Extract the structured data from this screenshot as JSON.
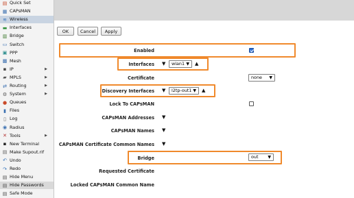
{
  "sidebar": {
    "items": [
      {
        "label": "Quick Set",
        "icon": "quick-set-icon",
        "glyph": "▤"
      },
      {
        "label": "CAPsMAN",
        "icon": "capsman-icon",
        "glyph": "▦"
      },
      {
        "label": "Wireless",
        "icon": "wireless-icon",
        "glyph": "≋"
      },
      {
        "label": "Interfaces",
        "icon": "interfaces-icon",
        "glyph": "▬"
      },
      {
        "label": "Bridge",
        "icon": "bridge-icon",
        "glyph": "▥"
      },
      {
        "label": "Switch",
        "icon": "switch-icon",
        "glyph": "▭"
      },
      {
        "label": "PPP",
        "icon": "ppp-icon",
        "glyph": "▣"
      },
      {
        "label": "Mesh",
        "icon": "mesh-icon",
        "glyph": "▩"
      },
      {
        "label": "IP",
        "icon": "ip-icon",
        "glyph": "▪"
      },
      {
        "label": "MPLS",
        "icon": "mpls-icon",
        "glyph": "▰"
      },
      {
        "label": "Routing",
        "icon": "routing-icon",
        "glyph": "⇄"
      },
      {
        "label": "System",
        "icon": "system-icon",
        "glyph": "⚙"
      },
      {
        "label": "Queues",
        "icon": "queues-icon",
        "glyph": "●"
      },
      {
        "label": "Files",
        "icon": "files-icon",
        "glyph": "▮"
      },
      {
        "label": "Log",
        "icon": "log-icon",
        "glyph": "▯"
      },
      {
        "label": "Radius",
        "icon": "radius-icon",
        "glyph": "◉"
      },
      {
        "label": "Tools",
        "icon": "tools-icon",
        "glyph": "✕"
      },
      {
        "label": "New Terminal",
        "icon": "terminal-icon",
        "glyph": "▪"
      },
      {
        "label": "Make Supout.rif",
        "icon": "supout-icon",
        "glyph": "▤"
      },
      {
        "label": "Undo",
        "icon": "undo-icon",
        "glyph": "↶"
      },
      {
        "label": "Redo",
        "icon": "redo-icon",
        "glyph": "↷"
      },
      {
        "label": "Hide Menu",
        "icon": "hide-menu-icon",
        "glyph": "▤"
      },
      {
        "label": "Hide Passwords",
        "icon": "hide-passwords-icon",
        "glyph": "▤"
      },
      {
        "label": "Safe Mode",
        "icon": "safe-mode-icon",
        "glyph": "▤"
      }
    ],
    "submenu_arrow": "▶",
    "selected": "Wireless"
  },
  "toolbar": {
    "ok_label": "OK",
    "cancel_label": "Cancel",
    "apply_label": "Apply"
  },
  "form": {
    "enabled": {
      "label": "Enabled",
      "checked": true
    },
    "interfaces": {
      "label": "Interfaces",
      "value": "wlan1"
    },
    "certificate": {
      "label": "Certificate",
      "value": "none"
    },
    "discovery_interfaces": {
      "label": "Discovery Interfaces",
      "value": "l2tp-out1"
    },
    "lock_to_capsman": {
      "label": "Lock To CAPsMAN",
      "checked": false
    },
    "capsman_addresses": {
      "label": "CAPsMAN Addresses"
    },
    "capsman_names": {
      "label": "CAPsMAN Names"
    },
    "capsman_cert_common_names": {
      "label": "CAPsMAN Certificate Common Names"
    },
    "bridge": {
      "label": "Bridge",
      "value": "out"
    },
    "requested_certificate": {
      "label": "Requested Certificate"
    },
    "locked_capsman_common_name": {
      "label": "Locked CAPsMAN Common Name"
    }
  },
  "glyphs": {
    "dropdown": "▼",
    "expand": "▼",
    "collapse": "▲"
  },
  "colors": {
    "highlight": "#f0892b",
    "selected_bg": "#c9d4e2",
    "checkbox": "#2d6fd3"
  }
}
